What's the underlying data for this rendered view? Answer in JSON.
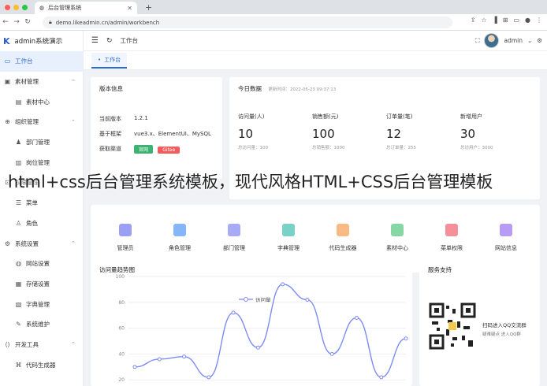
{
  "browser": {
    "tab_title": "后台管理系统",
    "url": "demo.likeadmin.cn/admin/workbench"
  },
  "sidebar": {
    "app_title": "admin系统演示",
    "items": [
      {
        "label": "工作台",
        "icon": "monitor-icon"
      },
      {
        "label": "素材管理",
        "icon": "picture-icon"
      },
      {
        "label": "素材中心",
        "icon": "folder-icon"
      },
      {
        "label": "组织管理",
        "icon": "org-icon"
      },
      {
        "label": "部门管理",
        "icon": "user-icon"
      },
      {
        "label": "岗位管理",
        "icon": "briefcase-icon"
      },
      {
        "label": "权限管理",
        "icon": "lock-icon"
      },
      {
        "label": "菜单",
        "icon": "menu-icon"
      },
      {
        "label": "角色",
        "icon": "role-icon"
      },
      {
        "label": "系统设置",
        "icon": "gear-icon"
      },
      {
        "label": "网站设置",
        "icon": "globe-icon"
      },
      {
        "label": "存储设置",
        "icon": "storage-icon"
      },
      {
        "label": "字典管理",
        "icon": "book-icon"
      },
      {
        "label": "系统维护",
        "icon": "tool-icon"
      },
      {
        "label": "开发工具",
        "icon": "code-icon"
      },
      {
        "label": "代码生成器",
        "icon": "code-gen-icon"
      }
    ]
  },
  "topbar": {
    "breadcrumb": "工作台",
    "user": "admin"
  },
  "tags": {
    "active": "工作台"
  },
  "version_card": {
    "title": "版本信息",
    "rows": [
      {
        "key": "当前版本",
        "value": "1.2.1"
      },
      {
        "key": "基于框架",
        "value": "vue3.x、ElementUI、MySQL"
      },
      {
        "key": "获取渠道",
        "value": ""
      }
    ],
    "btn_official": "官网",
    "btn_gitee": "Gitee"
  },
  "today_card": {
    "title": "今日数据",
    "update_time": "更新时间：2022-06-23 09:37:13",
    "stats": [
      {
        "label": "访问量(人)",
        "value": "10",
        "sub": "总访问量：100"
      },
      {
        "label": "销售额(元)",
        "value": "100",
        "sub": "总销售额：1000"
      },
      {
        "label": "订单量(笔)",
        "value": "12",
        "sub": "总订单量：255"
      },
      {
        "label": "新增用户",
        "value": "30",
        "sub": "总访用户：3000"
      }
    ]
  },
  "quick_menu": [
    {
      "label": "管理员",
      "color": "#7b7ff0"
    },
    {
      "label": "角色管理",
      "color": "#5b9df5"
    },
    {
      "label": "部门管理",
      "color": "#8a8ef2"
    },
    {
      "label": "字典管理",
      "color": "#4cc3b1"
    },
    {
      "label": "代码生成器",
      "color": "#f7a35c"
    },
    {
      "label": "素材中心",
      "color": "#5ec986"
    },
    {
      "label": "菜单权限",
      "color": "#f26b7a"
    },
    {
      "label": "网站信息",
      "color": "#a07bf0"
    }
  ],
  "trend_card": {
    "title": "访问量趋势图"
  },
  "support_card": {
    "title": "服务支持",
    "qq_line": "扫码进入QQ交流群",
    "qq_sub": "疑难疑点 进入QQ群"
  },
  "overlay_text": "html+css后台管理系统模板，现代风格HTML+CSS后台管理模板",
  "chart_data": {
    "type": "line",
    "series": [
      {
        "name": "访问量",
        "values": [
          30,
          36,
          38,
          22,
          72,
          45,
          94,
          82,
          40,
          68,
          22,
          52
        ]
      }
    ],
    "yticks": [
      20,
      40,
      60,
      80,
      100
    ],
    "ylim": [
      0,
      110
    ],
    "legend": "top-center",
    "color": "#7e8bf5"
  }
}
